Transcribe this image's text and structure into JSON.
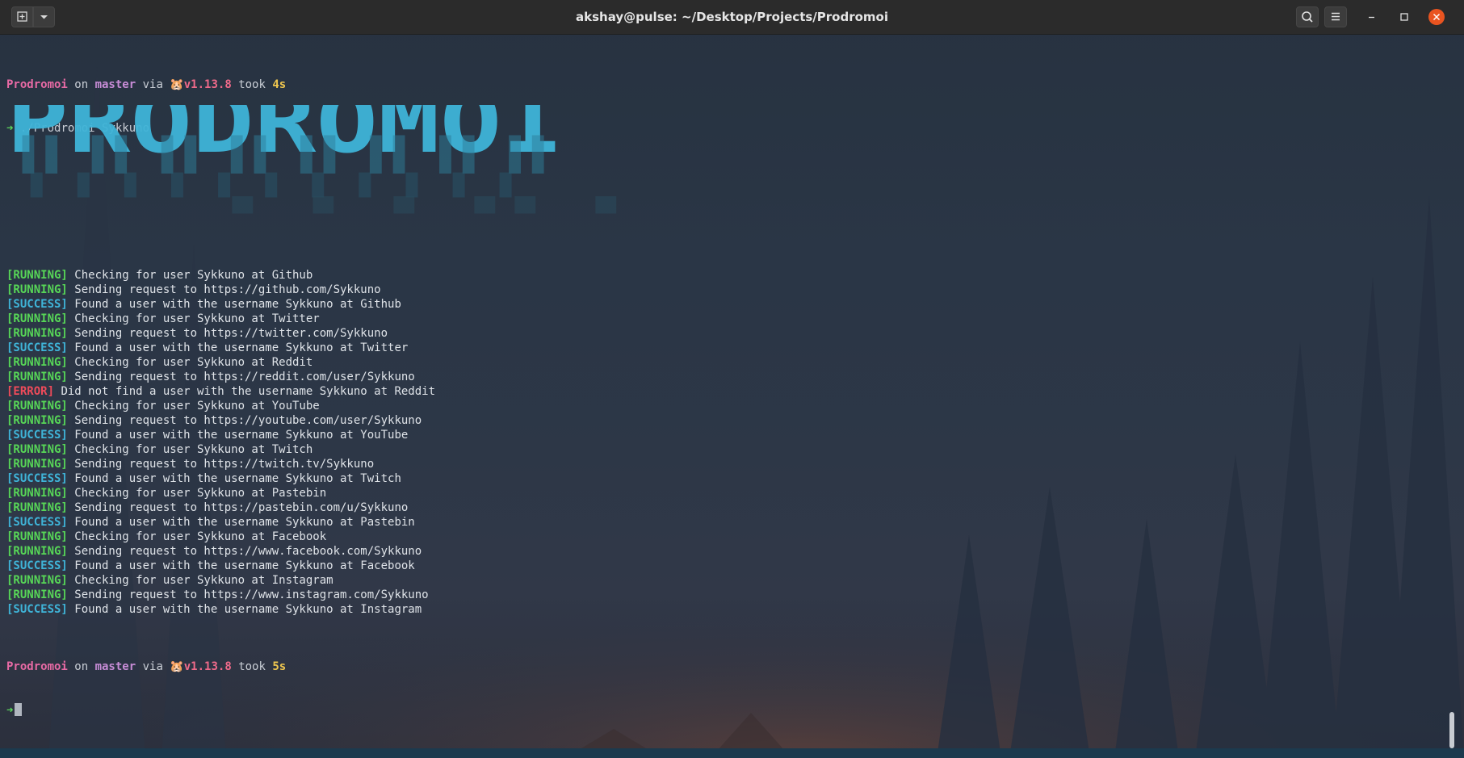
{
  "window": {
    "title": "akshay@pulse: ~/Desktop/Projects/Prodromoi",
    "icons": {
      "new_tab": "new-tab-icon",
      "tab_menu": "chevron-down-icon",
      "search": "search-icon",
      "menu": "hamburger-menu-icon",
      "minimize": "minimize-icon",
      "maximize": "maximize-icon",
      "close": "close-icon"
    }
  },
  "prompt1": {
    "dir": "Prodromoi",
    "on": " on ",
    "branch_icon": "",
    "branch": "master",
    "via": " via ",
    "runtime_icon": "🐹",
    "version": "v1.13.8",
    "took_label": " took ",
    "duration": "4s",
    "arrow": "➜",
    "command": "./Prodromoi Sykkuno"
  },
  "banner": {
    "text": "PRODROMOI",
    "color": "#3fb4d8"
  },
  "log": [
    {
      "tag": "[RUNNING]",
      "type": "run",
      "msg": " Checking for user Sykkuno at Github"
    },
    {
      "tag": "[RUNNING]",
      "type": "run",
      "msg": " Sending request to https://github.com/Sykkuno"
    },
    {
      "tag": "[SUCCESS]",
      "type": "ok",
      "msg": " Found a user with the username Sykkuno at Github"
    },
    {
      "tag": "[RUNNING]",
      "type": "run",
      "msg": " Checking for user Sykkuno at Twitter"
    },
    {
      "tag": "[RUNNING]",
      "type": "run",
      "msg": " Sending request to https://twitter.com/Sykkuno"
    },
    {
      "tag": "[SUCCESS]",
      "type": "ok",
      "msg": " Found a user with the username Sykkuno at Twitter"
    },
    {
      "tag": "[RUNNING]",
      "type": "run",
      "msg": " Checking for user Sykkuno at Reddit"
    },
    {
      "tag": "[RUNNING]",
      "type": "run",
      "msg": " Sending request to https://reddit.com/user/Sykkuno"
    },
    {
      "tag": "[ERROR]",
      "type": "err",
      "msg": " Did not find a user with the username Sykkuno at Reddit"
    },
    {
      "tag": "[RUNNING]",
      "type": "run",
      "msg": " Checking for user Sykkuno at YouTube"
    },
    {
      "tag": "[RUNNING]",
      "type": "run",
      "msg": " Sending request to https://youtube.com/user/Sykkuno"
    },
    {
      "tag": "[SUCCESS]",
      "type": "ok",
      "msg": " Found a user with the username Sykkuno at YouTube"
    },
    {
      "tag": "[RUNNING]",
      "type": "run",
      "msg": " Checking for user Sykkuno at Twitch"
    },
    {
      "tag": "[RUNNING]",
      "type": "run",
      "msg": " Sending request to https://twitch.tv/Sykkuno"
    },
    {
      "tag": "[SUCCESS]",
      "type": "ok",
      "msg": " Found a user with the username Sykkuno at Twitch"
    },
    {
      "tag": "[RUNNING]",
      "type": "run",
      "msg": " Checking for user Sykkuno at Pastebin"
    },
    {
      "tag": "[RUNNING]",
      "type": "run",
      "msg": " Sending request to https://pastebin.com/u/Sykkuno"
    },
    {
      "tag": "[SUCCESS]",
      "type": "ok",
      "msg": " Found a user with the username Sykkuno at Pastebin"
    },
    {
      "tag": "[RUNNING]",
      "type": "run",
      "msg": " Checking for user Sykkuno at Facebook"
    },
    {
      "tag": "[RUNNING]",
      "type": "run",
      "msg": " Sending request to https://www.facebook.com/Sykkuno"
    },
    {
      "tag": "[SUCCESS]",
      "type": "ok",
      "msg": " Found a user with the username Sykkuno at Facebook"
    },
    {
      "tag": "[RUNNING]",
      "type": "run",
      "msg": " Checking for user Sykkuno at Instagram"
    },
    {
      "tag": "[RUNNING]",
      "type": "run",
      "msg": " Sending request to https://www.instagram.com/Sykkuno"
    },
    {
      "tag": "[SUCCESS]",
      "type": "ok",
      "msg": " Found a user with the username Sykkuno at Instagram"
    }
  ],
  "prompt2": {
    "dir": "Prodromoi",
    "on": " on ",
    "branch_icon": "",
    "branch": "master",
    "via": " via ",
    "runtime_icon": "🐹",
    "version": "v1.13.8",
    "took_label": " took ",
    "duration": "5s",
    "arrow": "➜"
  },
  "colors": {
    "running": "#57d657",
    "success": "#3fb4d8",
    "error": "#ef4b5a",
    "accent_close": "#e95420"
  }
}
